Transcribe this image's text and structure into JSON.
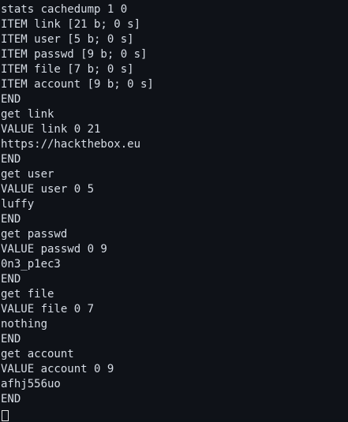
{
  "terminal": {
    "lines": [
      "stats cachedump 1 0",
      "ITEM link [21 b; 0 s]",
      "ITEM user [5 b; 0 s]",
      "ITEM passwd [9 b; 0 s]",
      "ITEM file [7 b; 0 s]",
      "ITEM account [9 b; 0 s]",
      "END",
      "get link",
      "VALUE link 0 21",
      "https://hackthebox.eu",
      "END",
      "get user",
      "VALUE user 0 5",
      "luffy",
      "END",
      "get passwd",
      "VALUE passwd 0 9",
      "0n3_p1ec3",
      "END",
      "get file",
      "VALUE file 0 7",
      "nothing",
      "END",
      "get account",
      "VALUE account 0 9",
      "afhj556uo",
      "END"
    ],
    "colors": {
      "background": "#0f1218",
      "text": "#d7dde6",
      "cursor": "#e6e6e6"
    }
  }
}
